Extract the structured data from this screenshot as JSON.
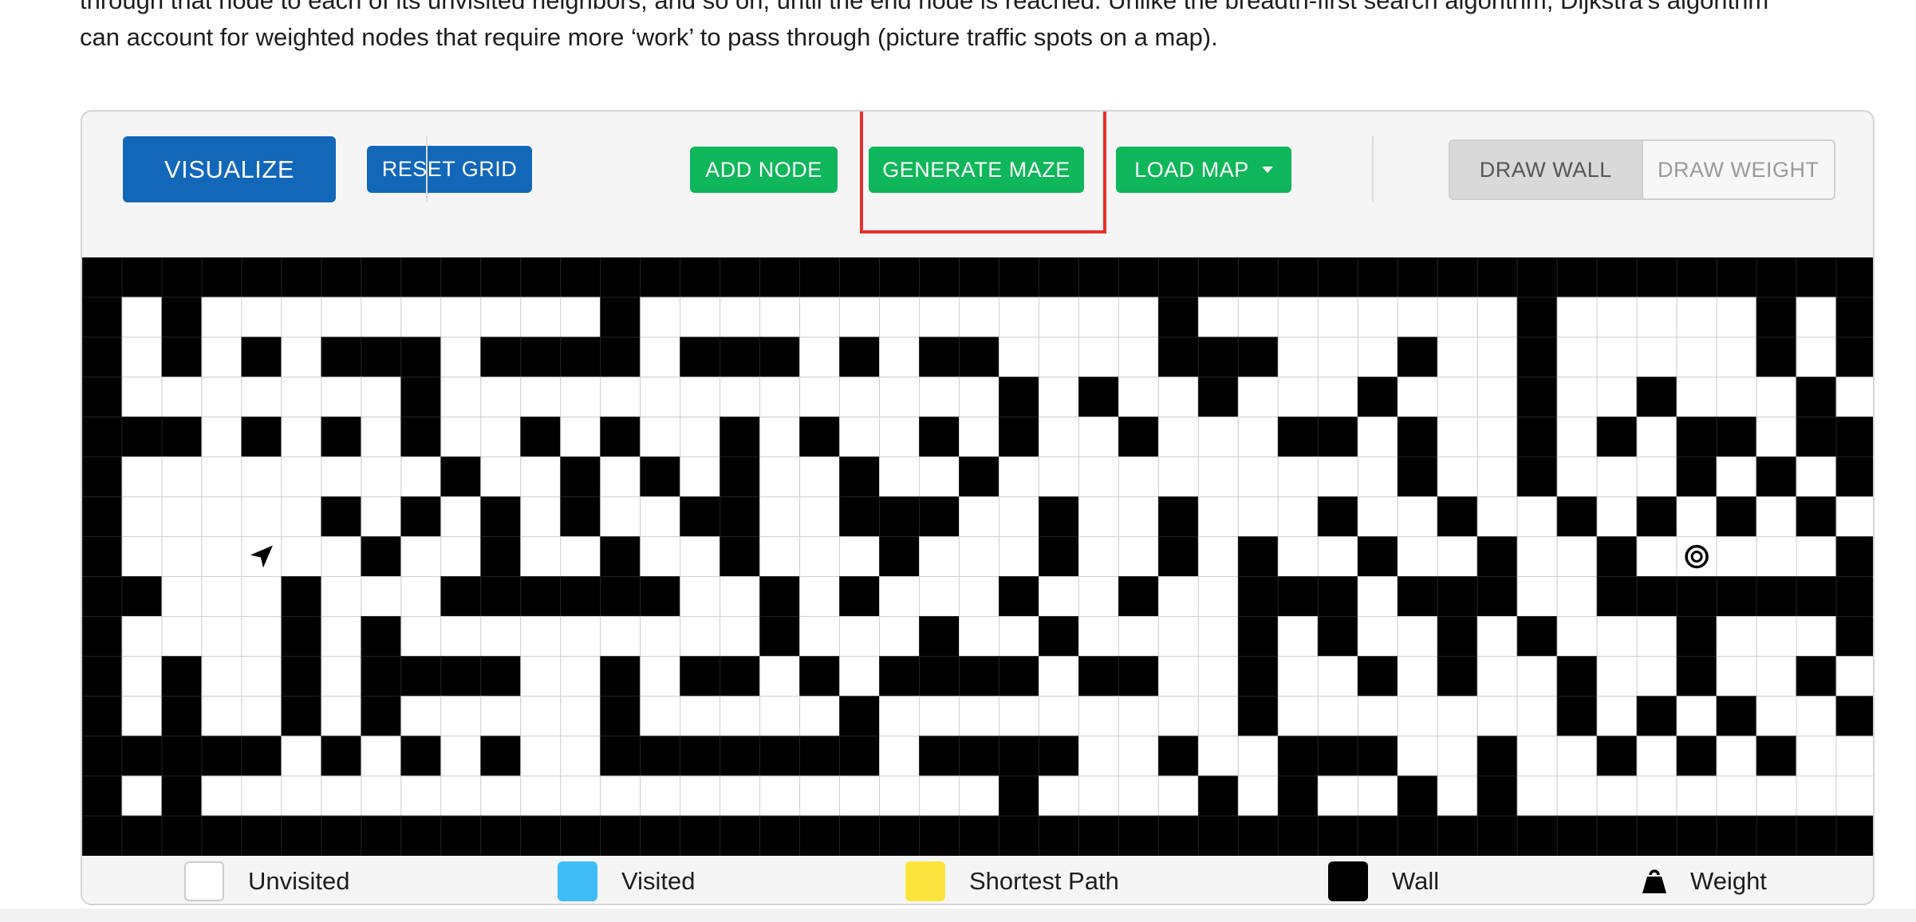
{
  "intro": {
    "line1": "through that node to each of its unvisited neighbors, and so on, until the end node is reached. Unlike the breadth-first search algorithm, Dijkstra’s algorithm",
    "line2": "can account for weighted nodes that require more ‘work’ to pass through (picture traffic spots on a map)."
  },
  "toolbar": {
    "visualize_label": "VISUALIZE",
    "reset_label": "RESET GRID",
    "add_node_label": "ADD NODE",
    "generate_maze_label": "GENERATE MAZE",
    "load_map_label": "LOAD MAP",
    "draw_wall_label": "DRAW WALL",
    "draw_weight_label": "DRAW WEIGHT",
    "draw_mode_selected": "DRAW WALL"
  },
  "colors": {
    "primary_blue": "#1267b8",
    "action_green": "#0fb65a",
    "highlight_red": "#e8302a",
    "unvisited": "#ffffff",
    "visited": "#3fbdf6",
    "shortest_path": "#fde43c",
    "wall": "#000000"
  },
  "grid": {
    "rows": 15,
    "cols": 45,
    "start_icon": "navigation-arrow-icon",
    "target_icon": "target-icon",
    "start": [
      7,
      4
    ],
    "target": [
      7,
      40
    ],
    "cells": [
      "#############################################",
      "#.#..........#.............#........#.....#.#",
      "#.#.#.###.####.###.#.##....###...#..#.....#.#",
      "#.......#..............#.#..#...#...#..#...#.#",
      "###.#.#.#..#.#..#.#..#.#..#...##.#..#.#.##.##",
      "#........#..#.#.#..#..#..........#..#...#.#.#",
      "#.....#.#.#.#..##..###..#..#...#..#..#.#.#.#.#",
      "#....S.#..#..#..#...#...#..#.#..#..#..#....T#.#",
      "##...#...######..#.#...#..#..###.###..#######.##",
      "#....#.#.........#...#..#....#.#..#.#...#...#.#",
      "#.#..#.####..#.##.#.####.##..#..#.#..#..#..#..#",
      "#.#..#.#.....#.....#.........#.......#.#.#..#.#",
      "#####.#.#.#..#######.####..#..###..#..#.#.#..##",
      "#.#....................#....#.#..#.#.........#",
      "#############################################"
    ]
  },
  "legend": [
    {
      "label": "Unvisited",
      "icon": "unvisited-swatch"
    },
    {
      "label": "Visited",
      "icon": "visited-swatch"
    },
    {
      "label": "Shortest Path",
      "icon": "shortest-path-swatch"
    },
    {
      "label": "Wall",
      "icon": "wall-swatch"
    },
    {
      "label": "Weight",
      "icon": "weight-icon"
    }
  ]
}
